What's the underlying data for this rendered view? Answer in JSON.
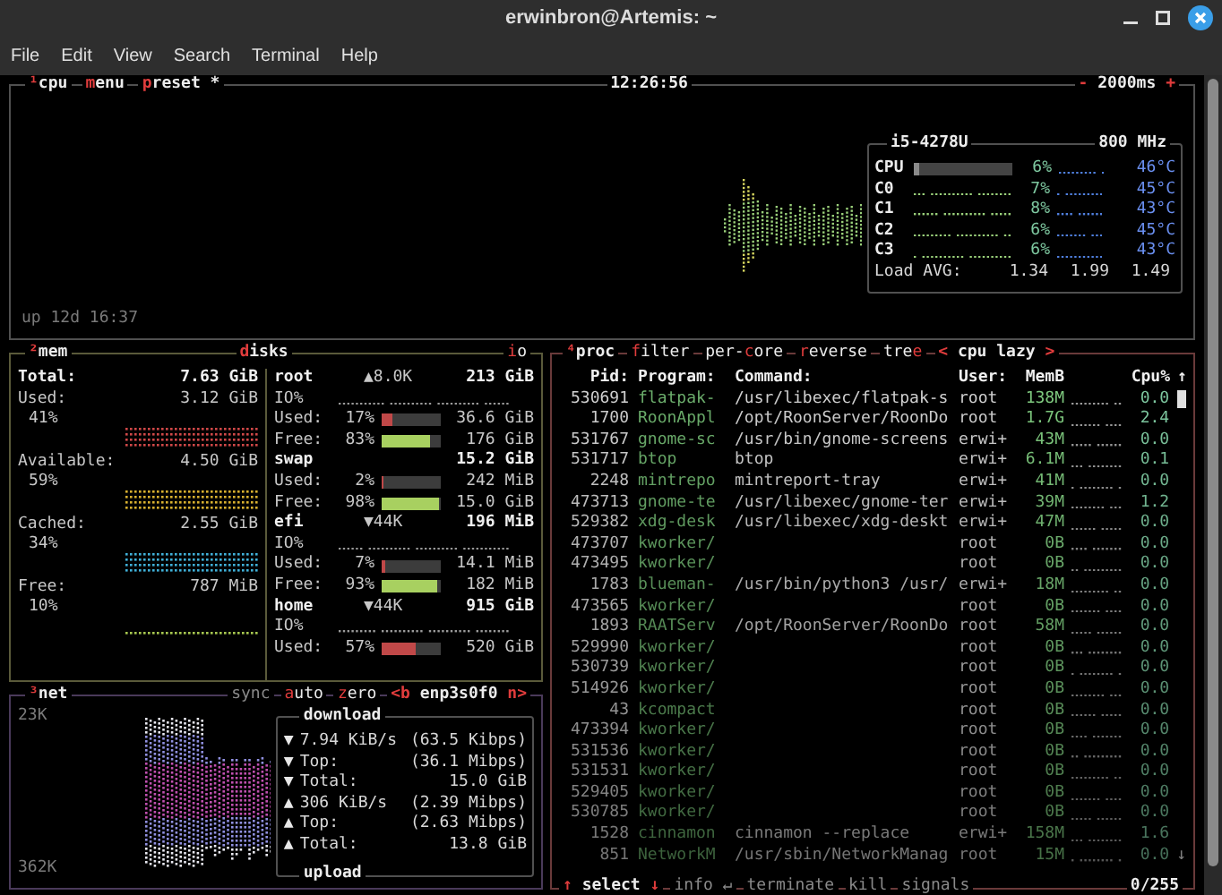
{
  "window": {
    "title": "erwinbron@Artemis: ~"
  },
  "menu": [
    "File",
    "Edit",
    "View",
    "Search",
    "Terminal",
    "Help"
  ],
  "cpu": {
    "tabs": [
      [
        {
          "text": "¹",
          "hot": true
        },
        {
          "text": "cpu",
          "hot": false
        }
      ],
      [
        {
          "text": "m",
          "hot": true
        },
        {
          "text": "enu",
          "hot": false
        }
      ],
      [
        {
          "text": "p",
          "hot": true
        },
        {
          "text": "reset *",
          "hot": false
        }
      ]
    ],
    "clock": "12:26:56",
    "interval": [
      {
        "text": "-",
        "hot": true
      },
      {
        "text": " 2000ms ",
        "hot": false
      },
      {
        "text": "+",
        "hot": true
      }
    ],
    "uptime": "up 12d 16:37",
    "model": "i5-4278U",
    "freq": "800 MHz",
    "cores": [
      {
        "kind": "meter",
        "name": "CPU",
        "level": 0.06,
        "percent": "6%",
        "temp": "46°C"
      },
      {
        "kind": "graph",
        "name": "C0",
        "percent": "7%",
        "temp": "45°C"
      },
      {
        "kind": "graph",
        "name": "C1",
        "percent": "8%",
        "temp": "43°C"
      },
      {
        "kind": "graph",
        "name": "C2",
        "percent": "6%",
        "temp": "45°C"
      },
      {
        "kind": "graph",
        "name": "C3",
        "percent": "6%",
        "temp": "43°C"
      }
    ],
    "load_label": "Load AVG:",
    "load": [
      "1.34",
      "1.99",
      "1.49"
    ]
  },
  "mem": {
    "title": [
      {
        "text": "²",
        "hot": true
      },
      {
        "text": "mem",
        "hot": false
      }
    ],
    "total_label": "Total:",
    "total": "7.63 GiB",
    "items": [
      {
        "label": "Used:",
        "value": "3.12 GiB",
        "percent": "41%",
        "color": "#d04848"
      },
      {
        "label": "Available:",
        "value": "4.50 GiB",
        "percent": "59%",
        "color": "#d8b030"
      },
      {
        "label": "Cached:",
        "value": "2.55 GiB",
        "percent": "34%",
        "color": "#40b0d8"
      },
      {
        "label": "Free:",
        "value": "787 MiB",
        "percent": "10%",
        "color": "#a8c850"
      }
    ]
  },
  "disks": {
    "title": [
      {
        "text": "d",
        "hot": true
      },
      {
        "text": "isks",
        "hot": false
      }
    ],
    "io_title": [
      {
        "text": "i",
        "hot": true
      },
      {
        "text": "o",
        "hot": false
      }
    ],
    "items": [
      {
        "name": "root",
        "io": "▲8.0K",
        "size": "213 GiB",
        "io_label": "IO%",
        "rows": [
          {
            "kind": "used",
            "label": "Used:",
            "percent": "17%",
            "level": 0.17,
            "value": "36.6 GiB"
          },
          {
            "kind": "free",
            "label": "Free:",
            "percent": "83%",
            "level": 0.83,
            "value": "176 GiB"
          }
        ]
      },
      {
        "name": "swap",
        "size": "15.2 GiB",
        "rows": [
          {
            "kind": "used",
            "label": "Used:",
            "percent": "2%",
            "level": 0.02,
            "value": "242 MiB"
          },
          {
            "kind": "free",
            "label": "Free:",
            "percent": "98%",
            "level": 0.98,
            "value": "15.0 GiB"
          }
        ]
      },
      {
        "name": "efi",
        "io": "▼44K",
        "size": "196 MiB",
        "io_label": "IO%",
        "rows": [
          {
            "kind": "used",
            "label": "Used:",
            "percent": "7%",
            "level": 0.07,
            "value": "14.1 MiB"
          },
          {
            "kind": "free",
            "label": "Free:",
            "percent": "93%",
            "level": 0.93,
            "value": "182 MiB"
          }
        ]
      },
      {
        "name": "home",
        "io": "▼44K",
        "size": "915 GiB",
        "io_label": "IO%",
        "rows": [
          {
            "kind": "used",
            "label": "Used:",
            "percent": "57%",
            "level": 0.57,
            "value": "520 GiB"
          }
        ]
      }
    ]
  },
  "net": {
    "title": [
      {
        "text": "³",
        "hot": true
      },
      {
        "text": "net",
        "hot": false
      }
    ],
    "buttons": [
      [
        {
          "text": "sync",
          "hot": false
        }
      ],
      [
        {
          "text": "a",
          "hot": true
        },
        {
          "text": "uto",
          "hot": false
        }
      ],
      [
        {
          "text": "z",
          "hot": true
        },
        {
          "text": "ero",
          "hot": false
        }
      ],
      [
        {
          "text": "<b",
          "hot": true
        },
        {
          "text": " enp3s0f0 ",
          "hot": false
        },
        {
          "text": "n>",
          "hot": true
        }
      ]
    ],
    "scale_top": "23K",
    "scale_bottom": "362K",
    "box_title": "download",
    "box_bottom": "upload",
    "rows": [
      {
        "arrow": "▼",
        "label": "7.94 KiB/s",
        "value": "(63.5 Kibps)"
      },
      {
        "arrow": "▼",
        "label": "Top:",
        "value": "(36.1 Mibps)"
      },
      {
        "arrow": "▼",
        "label": "Total:",
        "value": "15.0 GiB"
      },
      {
        "arrow": "▲",
        "label": "306 KiB/s",
        "value": "(2.39 Mibps)"
      },
      {
        "arrow": "▲",
        "label": "Top:",
        "value": "(2.63 Mibps)"
      },
      {
        "arrow": "▲",
        "label": "Total:",
        "value": "13.8 GiB"
      }
    ]
  },
  "proc": {
    "title": [
      [
        {
          "text": "⁴",
          "hot": true
        },
        {
          "text": "proc",
          "hot": false
        }
      ],
      [
        {
          "text": "f",
          "hot": true
        },
        {
          "text": "ilter",
          "hot": false
        }
      ],
      [
        {
          "text": "per-",
          "hot": false
        },
        {
          "text": "c",
          "hot": true
        },
        {
          "text": "ore",
          "hot": false
        }
      ],
      [
        {
          "text": "r",
          "hot": true
        },
        {
          "text": "everse",
          "hot": false
        }
      ],
      [
        {
          "text": "tre",
          "hot": false
        },
        {
          "text": "e",
          "hot": true
        }
      ],
      [
        {
          "text": "<",
          "hot": true
        },
        {
          "text": " cpu lazy ",
          "hot": false
        },
        {
          "text": ">",
          "hot": true
        }
      ]
    ],
    "columns": [
      "Pid:",
      "Program:",
      "Command:",
      "User:",
      "MemB",
      "Cpu%"
    ],
    "scroll_up": "↑",
    "scroll_down": "↓",
    "rows": [
      {
        "pid": "530691",
        "program": "flatpak-",
        "command": "/usr/libexec/flatpak-s",
        "user": "root",
        "mem": "138M",
        "cpu": "0.0"
      },
      {
        "pid": "1700",
        "program": "RoonAppl",
        "command": "/opt/RoonServer/RoonDo",
        "user": "root",
        "mem": "1.7G",
        "cpu": "2.4"
      },
      {
        "pid": "531767",
        "program": "gnome-sc",
        "command": "/usr/bin/gnome-screens",
        "user": "erwi+",
        "mem": "43M",
        "cpu": "0.0"
      },
      {
        "pid": "531717",
        "program": "btop",
        "command": "btop",
        "user": "erwi+",
        "mem": "6.1M",
        "cpu": "0.1"
      },
      {
        "pid": "2248",
        "program": "mintrepo",
        "command": "mintreport-tray",
        "user": "erwi+",
        "mem": "41M",
        "cpu": "0.0"
      },
      {
        "pid": "473713",
        "program": "gnome-te",
        "command": "/usr/libexec/gnome-ter",
        "user": "erwi+",
        "mem": "39M",
        "cpu": "1.2"
      },
      {
        "pid": "529382",
        "program": "xdg-desk",
        "command": "/usr/libexec/xdg-deskt",
        "user": "erwi+",
        "mem": "47M",
        "cpu": "0.0"
      },
      {
        "pid": "473707",
        "program": "kworker/",
        "user": "root",
        "mem": "0B",
        "cpu": "0.0"
      },
      {
        "pid": "473495",
        "program": "kworker/",
        "user": "root",
        "mem": "0B",
        "cpu": "0.0"
      },
      {
        "pid": "1783",
        "program": "blueman-",
        "command": "/usr/bin/python3 /usr/",
        "user": "erwi+",
        "mem": "18M",
        "cpu": "0.0"
      },
      {
        "pid": "473565",
        "program": "kworker/",
        "user": "root",
        "mem": "0B",
        "cpu": "0.0"
      },
      {
        "pid": "1893",
        "program": "RAATServ",
        "command": "/opt/RoonServer/RoonDo",
        "user": "root",
        "mem": "58M",
        "cpu": "0.0"
      },
      {
        "pid": "529990",
        "program": "kworker/",
        "user": "root",
        "mem": "0B",
        "cpu": "0.0"
      },
      {
        "pid": "530739",
        "program": "kworker/",
        "user": "root",
        "mem": "0B",
        "cpu": "0.0"
      },
      {
        "pid": "514926",
        "program": "kworker/",
        "user": "root",
        "mem": "0B",
        "cpu": "0.0"
      },
      {
        "pid": "43",
        "program": "kcompact",
        "user": "root",
        "mem": "0B",
        "cpu": "0.0"
      },
      {
        "pid": "473394",
        "program": "kworker/",
        "user": "root",
        "mem": "0B",
        "cpu": "0.0"
      },
      {
        "pid": "531536",
        "program": "kworker/",
        "user": "root",
        "mem": "0B",
        "cpu": "0.0"
      },
      {
        "pid": "531531",
        "program": "kworker/",
        "user": "root",
        "mem": "0B",
        "cpu": "0.0"
      },
      {
        "pid": "529405",
        "program": "kworker/",
        "user": "root",
        "mem": "0B",
        "cpu": "0.0"
      },
      {
        "pid": "530785",
        "program": "kworker/",
        "user": "root",
        "mem": "0B",
        "cpu": "0.0"
      },
      {
        "pid": "1528",
        "program": "cinnamon",
        "command": "cinnamon --replace",
        "user": "erwi+",
        "mem": "158M",
        "cpu": "1.6"
      },
      {
        "pid": "851",
        "program": "NetworkM",
        "command": "/usr/sbin/NetworkManag",
        "user": "root",
        "mem": "15M",
        "cpu": "0.0"
      }
    ],
    "footer": [
      {
        "dim": false,
        "parts": [
          {
            "text": "↑",
            "hot": true
          },
          {
            "text": " select ",
            "hot": false
          },
          {
            "text": "↓",
            "hot": true
          }
        ]
      },
      {
        "dim": true,
        "parts": [
          {
            "text": "info ↵",
            "hot": false
          }
        ]
      },
      {
        "dim": true,
        "parts": [
          {
            "text": "terminate",
            "hot": false
          }
        ]
      },
      {
        "dim": true,
        "parts": [
          {
            "text": "kill",
            "hot": false
          }
        ]
      },
      {
        "dim": true,
        "parts": [
          {
            "text": "signals",
            "hot": false
          }
        ]
      }
    ],
    "count": "0/255"
  }
}
